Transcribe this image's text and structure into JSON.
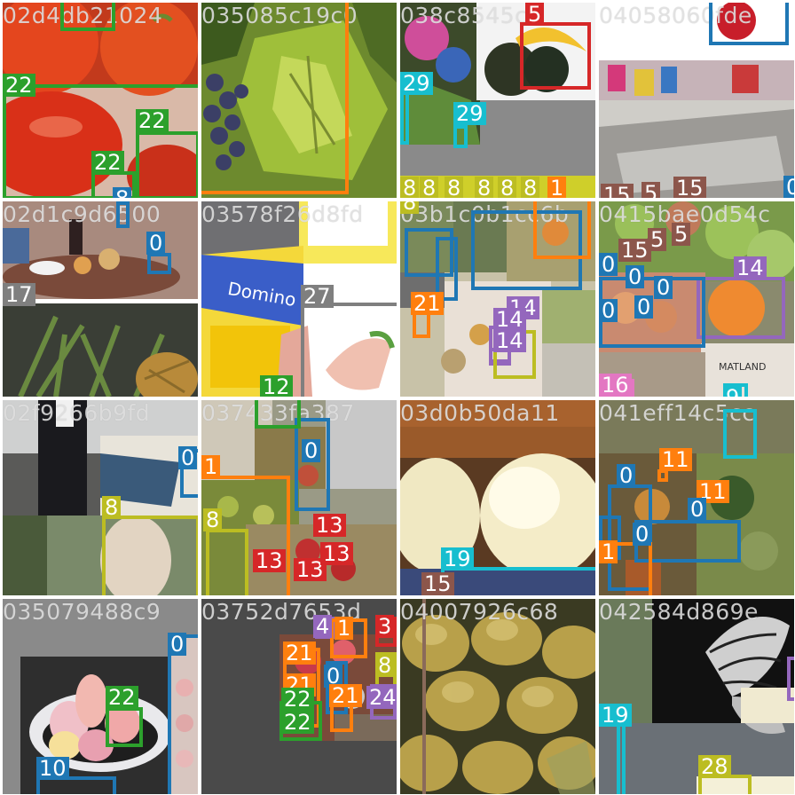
{
  "mosaic": {
    "tiles": [
      {
        "id": "02d4db21024",
        "labels": [
          "22",
          "22",
          "22",
          "8"
        ]
      },
      {
        "id": "035085c19c0",
        "labels": []
      },
      {
        "id": "038c8545cb",
        "labels": [
          "5",
          "29",
          "29",
          "1",
          "8",
          "8",
          "8",
          "8",
          "8",
          "8"
        ]
      },
      {
        "id": "04058060fde",
        "labels": [
          "15",
          "5",
          "15",
          "0"
        ]
      },
      {
        "id": "02d1c9d6500",
        "labels": [
          "0",
          "17"
        ]
      },
      {
        "id": "03578f26d8fd",
        "labels": [
          "27",
          "12"
        ]
      },
      {
        "id": "03b1c0b1cc6b",
        "labels": [
          "21",
          "8",
          "14",
          "14",
          "14"
        ]
      },
      {
        "id": "0415bae0d54c",
        "labels": [
          "15",
          "5",
          "5",
          "14",
          "0",
          "0",
          "0",
          "0",
          "0",
          "16",
          "9"
        ]
      },
      {
        "id": "02f9266b9fd",
        "labels": [
          "0",
          "8"
        ]
      },
      {
        "id": "037433fa387",
        "labels": [
          "0",
          "1",
          "8",
          "13",
          "13",
          "13",
          "13"
        ]
      },
      {
        "id": "03d0b50da11",
        "labels": [
          "19",
          "15"
        ]
      },
      {
        "id": "041eff14c5cc",
        "labels": [
          "0",
          "11",
          "11",
          "0",
          "0",
          "1"
        ]
      },
      {
        "id": "035079488c9",
        "labels": [
          "0",
          "22",
          "10"
        ]
      },
      {
        "id": "03752d7653d",
        "labels": [
          "4",
          "1",
          "3",
          "21",
          "0",
          "21",
          "21",
          "8",
          "22",
          "22",
          "24"
        ]
      },
      {
        "id": "04007926c68",
        "labels": []
      },
      {
        "id": "042584d869e",
        "labels": [
          "19",
          "28"
        ]
      }
    ]
  },
  "colors": {
    "class_0": "#1f77b4",
    "class_1": "#ff7f0e",
    "class_8": "#bcbd22",
    "class_9": "#17becf",
    "class_12": "#2ca02c",
    "class_13": "#d62728",
    "class_14": "#9467bd",
    "class_15": "#8c564b",
    "class_16": "#e377c2",
    "class_17": "#7f7f7f",
    "class_22": "#2ca02c",
    "class_29": "#17becf"
  }
}
